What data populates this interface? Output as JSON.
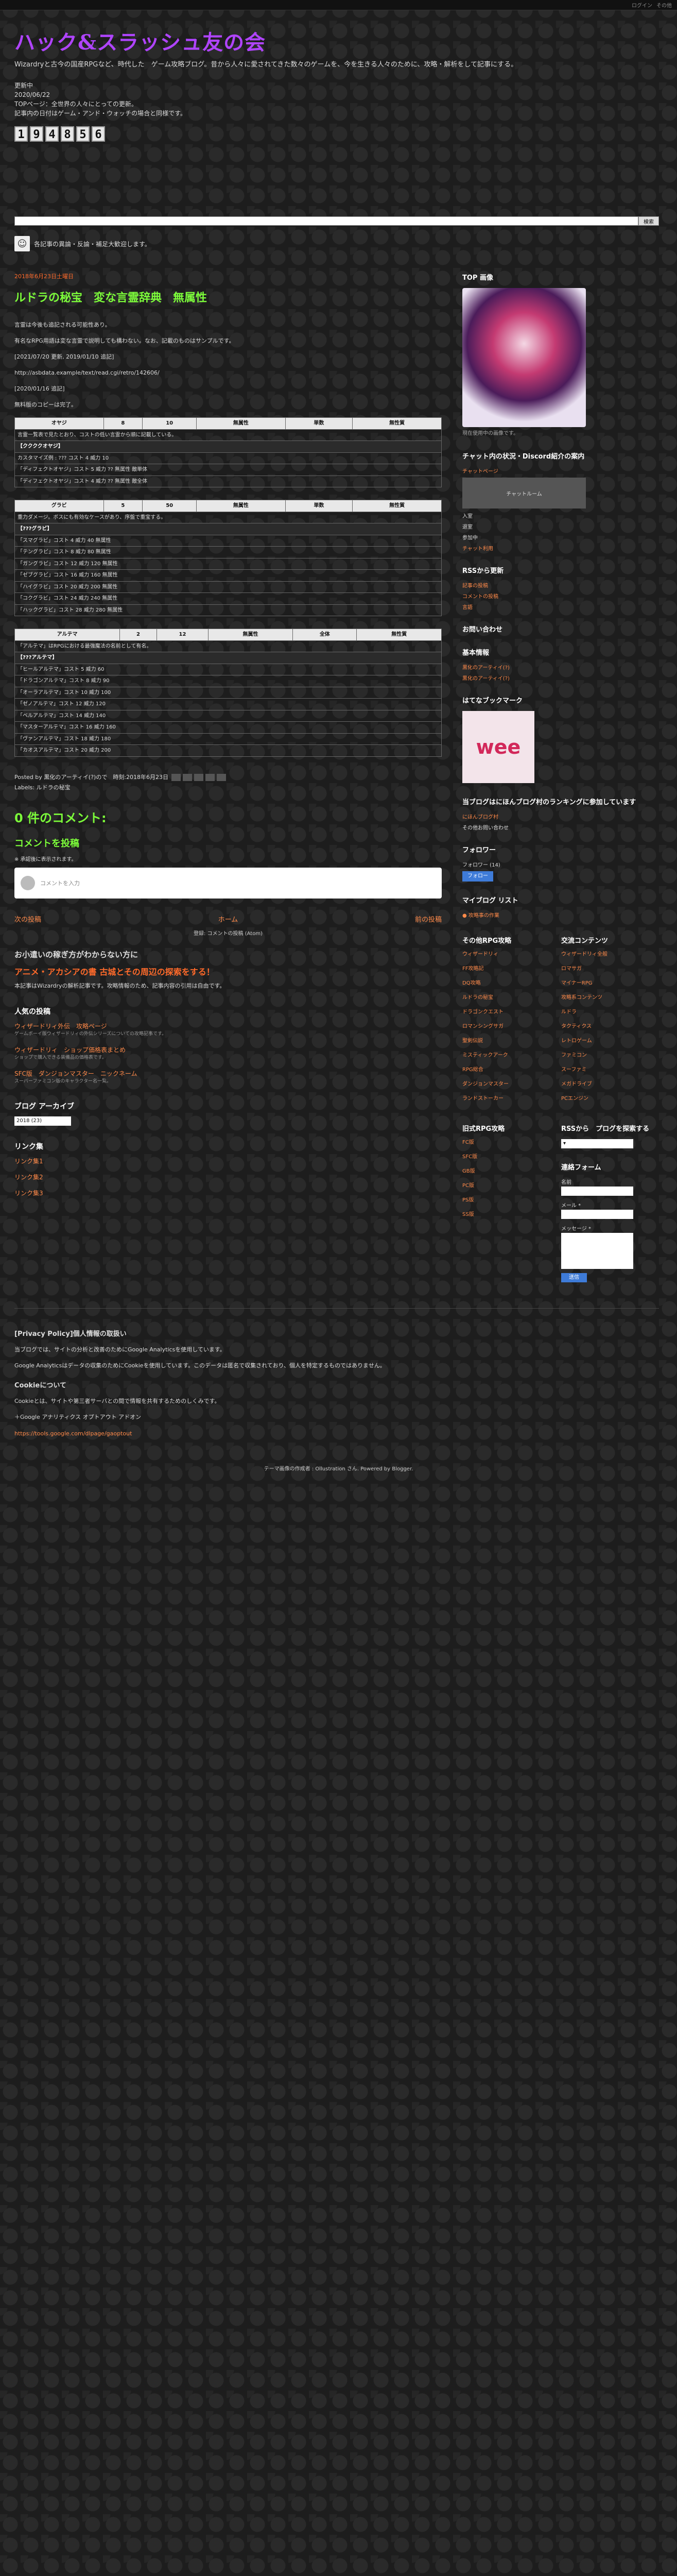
{
  "topbar": {
    "links": [
      "ログイン",
      "その他"
    ]
  },
  "blog": {
    "title": "ハック&スラッシュ友の会",
    "description": "Wizardryと古今の国産RPGなど、時代した　ゲーム攻略ブログ。昔から人々に愛されてきた数々のゲームを、今を生きる人々のために、攻略・解析をして記事にする。",
    "notes": [
      "更新中",
      "2020/06/22",
      "TOPページ：全世界の人々にとっての更新。",
      "記事内の日付はゲーム・アンド・ウォッチの場合と同様です。"
    ],
    "counter": [
      "1",
      "9",
      "4",
      "8",
      "5",
      "6"
    ]
  },
  "search": {
    "button": "検索",
    "placeholder": ""
  },
  "intro": {
    "text": "各記事の異論・反論・補足大歓迎します。"
  },
  "post": {
    "date": "2018年6月23日土曜日",
    "title": "ルドラの秘宝　変な言霊辞典　無属性",
    "paras": [
      "言霊は今後も追記される可能性あり。",
      "有名なRPG用語は変な言霊で説明しても構わない。なお、記載のものはサンプルです。",
      "[2021/07/20 更新, 2019/01/10 追記]",
      "http://asbdata.example/text/read.cgi/retro/142606/",
      "[2020/01/16 追記]",
      "無料版のコピーは完了。"
    ],
    "tables": [
      {
        "head": [
          "オヤジ",
          "8",
          "10",
          "無属性",
          "単数",
          "無性質"
        ],
        "desc": "言霊一覧表で見たとおり、コストの低い言霊から順に記載している。",
        "sec": "【ククククオヤジ】",
        "rows": [
          "カスタマイズ例 : ??? コスト 4 威力 10",
          "「ディフェクトオヤジ」コスト 5 威力 ?? 無属性 敵単体",
          "「ディフェクトオヤジ」コスト 4 威力 ?? 無属性 敵全体"
        ]
      },
      {
        "head": [
          "グラビ",
          "5",
          "50",
          "無属性",
          "単数",
          "無性質"
        ],
        "desc": "重力ダメージ。ボスにも有効なケースがあり、序盤で重宝する。",
        "sec": "【???グラビ】",
        "rows": [
          "「スマグラビ」コスト 4 威力 40 無属性",
          "「テングラビ」コスト 8 威力 80 無属性",
          "「ガングラビ」コスト 12 威力 120 無属性",
          "「ゼブグラビ」コスト 16 威力 160 無属性",
          "「ハイグラビ」コスト 20 威力 200 無属性",
          "「コクグラビ」コスト 24 威力 240 無属性",
          "「ハックグラビ」コスト 28 威力 280 無属性"
        ]
      },
      {
        "head": [
          "アルテマ",
          "2",
          "12",
          "無属性",
          "全体",
          "無性質"
        ],
        "desc": "「アルテマ」はRPGにおける最強魔法の名前として有名。",
        "sec": "【???アルテマ】",
        "rows": [
          "「ヒールアルテマ」コスト 5 威力 60",
          "「ドラゴンアルテマ」コスト 8 威力 90",
          "「オーラアルテマ」コスト 10 威力 100",
          "「ゼノアルテマ」コスト 12 威力 120",
          "「ベルアルテマ」コスト 14 威力 140",
          "「マスターアルテマ」コスト 16 威力 160",
          "「ヴァンアルテマ」コスト 18 威力 180",
          "「カオスアルテマ」コスト 20 威力 200"
        ]
      }
    ],
    "footer": {
      "posted": "Posted by 黒化のアーティイ(?)ので　時刻:2018年6月23日",
      "labels": "Labels: ルドラの秘宝"
    }
  },
  "comments": {
    "count": "0 件のコメント:",
    "post_title": "コメントを投稿",
    "note": "※ 承認後に表示されます。",
    "placeholder": "コメントを入力"
  },
  "pager": {
    "newer": "次の投稿",
    "home": "ホーム",
    "older": "前の投稿",
    "subscribe": "登録: コメントの投稿 (Atom)"
  },
  "ad": {
    "head": "お小遣いの稼ぎ方がわからない方に",
    "title": "アニメ・アカシアの書 古城とその周辺の探索をする！",
    "body": "本記事はWizardryの解析記事です。攻略情報のため、記事内容の引用は自由です。"
  },
  "popular": {
    "head": "人気の投稿",
    "items": [
      {
        "t": "ウィザードリィ外伝　攻略ページ",
        "d": "ゲームボーイ版ウィザードリィの外伝シリーズについての攻略記事です。"
      },
      {
        "t": "ウィザードリィ　ショップ価格表まとめ",
        "d": "ショップで購入できる装備品の価格表です。"
      },
      {
        "t": "SFC版　ダンジョンマスター　ニックネーム",
        "d": "スーパーファミコン版のキャラクター名一覧。"
      }
    ]
  },
  "archive": {
    "head": "ブログ アーカイブ",
    "select": "2018 (23)"
  },
  "links": {
    "head": "リンク集",
    "items": [
      "リンク集1",
      "リンク集2",
      "リンク集3"
    ]
  },
  "sidebar": {
    "top_head": "TOP 画像",
    "top_caption": "現在使用中の画像です。",
    "chat_head": "チャット内の状況・Discord紹介の案内",
    "chat_lines": [
      "チャットページ",
      "チャットルーム",
      "入室",
      "退室",
      "参加中"
    ],
    "chat_link": "チャット利用",
    "rss_head": "RSSから更新",
    "rss_items": [
      "記事の投稿",
      "コメントの投稿"
    ],
    "lang_link": "言語",
    "mail_head": "お問い合わせ",
    "info_head": "基本情報",
    "info_items": [
      "黒化のアーティイ(?)",
      "黒化のアーティイ(?)"
    ],
    "hatebo_head": "はてなブックマーク",
    "hatebo": "wee",
    "rank_head": "当ブログはにほんブログ村のランキングに参加しています",
    "rank_link": "にほんブログ村",
    "rank_note": "その他お問い合わせ",
    "follow_head": "フォロワー",
    "follow_count": "フォロワー (14)",
    "follow_btn": "フォロー",
    "mylist_head": "マイブログ リスト",
    "mylist_item": "● 攻略事の作業",
    "col1_head": "その他RPG攻略",
    "col1": [
      "ウィザードリィ",
      "FF攻略記",
      "DQ攻略",
      "ルドラの秘宝",
      "ドラゴンクエスト",
      "ロマンシングサガ",
      "聖剣伝説",
      "ミスティックアーク",
      "RPG総合",
      "ダンジョンマスター",
      "ランドストーカー"
    ],
    "col2_head": "交流コンテンツ",
    "col2": [
      "ウィザードリィ全般",
      "ロマサガ",
      "マイナーRPG",
      "攻略系コンテンツ",
      "ルドラ",
      "タクティクス",
      "レトロゲーム",
      "ファミコン",
      "スーファミ",
      "メガドライブ",
      "PCエンジン"
    ],
    "rss_list_head": "RSSから　プログを探索する",
    "contact_form_head": "連絡フォーム",
    "form_name": "名前",
    "form_mail": "メール *",
    "form_msg": "メッセージ *",
    "form_send": "送信",
    "other_head": "旧式RPG攻略",
    "other": [
      "FC版",
      "SFC版",
      "GB版",
      "PC版",
      "PS版",
      "SS版"
    ]
  },
  "privacy": {
    "head": "[Privacy Policy]個人情報の取扱い",
    "p1": "当ブログでは、サイトの分析と改善のためにGoogle Analyticsを使用しています。",
    "p2": "Google Analyticsはデータの収集のためにCookieを使用しています。このデータは匿名で収集されており、個人を特定するものではありません。",
    "cookie_head": "Cookieについて",
    "p3": "Cookieとは、サイトや第三者サーバとの間で情報を共有するためのしくみです。",
    "adhead": "＋Google アナリティクス オプトアウト アドオン",
    "adurl": "https://tools.google.com/dlpage/gaoptout"
  },
  "footer": {
    "text": "テーマ画像の作成者 : Ollustration さん. Powered by Blogger."
  }
}
